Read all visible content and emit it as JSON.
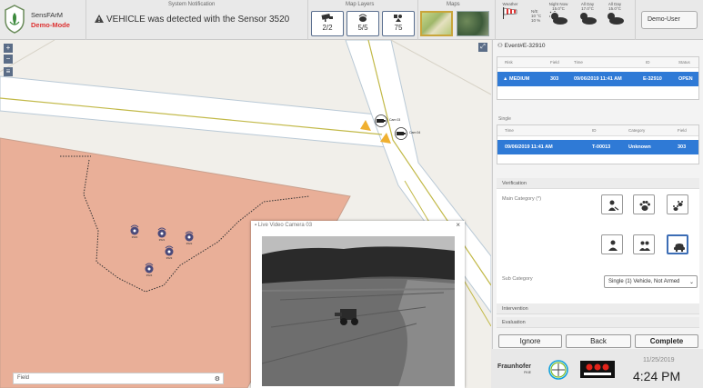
{
  "brand": {
    "name": "SensFArM",
    "mode": "Demo-Mode"
  },
  "notification": {
    "title": "System Notification",
    "message": "VEHICLE was detected with the Sensor 3520"
  },
  "map_layers": {
    "title": "Map Layers",
    "cameras": "2/2",
    "sensors": "5/5",
    "events": "75"
  },
  "maps": {
    "title": "Maps"
  },
  "weather": {
    "now_label": "Weather",
    "now_a": "N/E",
    "now_b": "10 °C",
    "now_c": "10 %",
    "cols": [
      {
        "label": "Night Now",
        "temp": "15.0°C"
      },
      {
        "label": "All Day",
        "temp": "17.0°C"
      },
      {
        "label": "All Day",
        "temp": "15.0°C"
      }
    ]
  },
  "user": {
    "name": "Demo-User"
  },
  "event": {
    "id_label": "Event#E-32910",
    "headers": [
      "Risk",
      "Field",
      "Time",
      "ID",
      "Status"
    ],
    "row": {
      "risk": "MEDIUM",
      "field": "303",
      "time": "09/06/2019 11:41 AM",
      "id": "E-32910",
      "status": "OPEN"
    }
  },
  "single": {
    "label": "Single",
    "headers": [
      "Time",
      "ID",
      "Category",
      "Field"
    ],
    "row": {
      "time": "09/06/2019 11:41 AM",
      "id": "T-00013",
      "category": "Unknown",
      "field": "303"
    }
  },
  "verification": {
    "title": "Verification",
    "main_category_label": "Main Category (*)",
    "sub_category_label": "Sub Category",
    "sub_category_value": "Single (1) Vehicle, Not Armed"
  },
  "sections": {
    "intervention": "Intervention",
    "evaluation": "Evaluation"
  },
  "buttons": {
    "ignore": "Ignore",
    "back": "Back",
    "complete": "Complete"
  },
  "video": {
    "title": "Live Video Camera 03"
  },
  "map": {
    "search_value": "Field"
  },
  "cameras": [
    {
      "label": "Cam 03"
    },
    {
      "label": "Cam 04"
    }
  ],
  "sensors": [
    {
      "label": "3520"
    },
    {
      "label": "3521"
    },
    {
      "label": "3522"
    },
    {
      "label": "3523"
    },
    {
      "label": "3524"
    }
  ],
  "footer": {
    "fraunhofer": "Fraunhofer",
    "fraunhofer_sub": "FKIE",
    "date": "11/25/2019",
    "time": "4:24 PM"
  },
  "colors": {
    "accent": "#2f7ad6",
    "field": "#e9af98",
    "road_edge": "#b9c9d6",
    "road_line": "#c2b948",
    "danger": "#d33"
  }
}
